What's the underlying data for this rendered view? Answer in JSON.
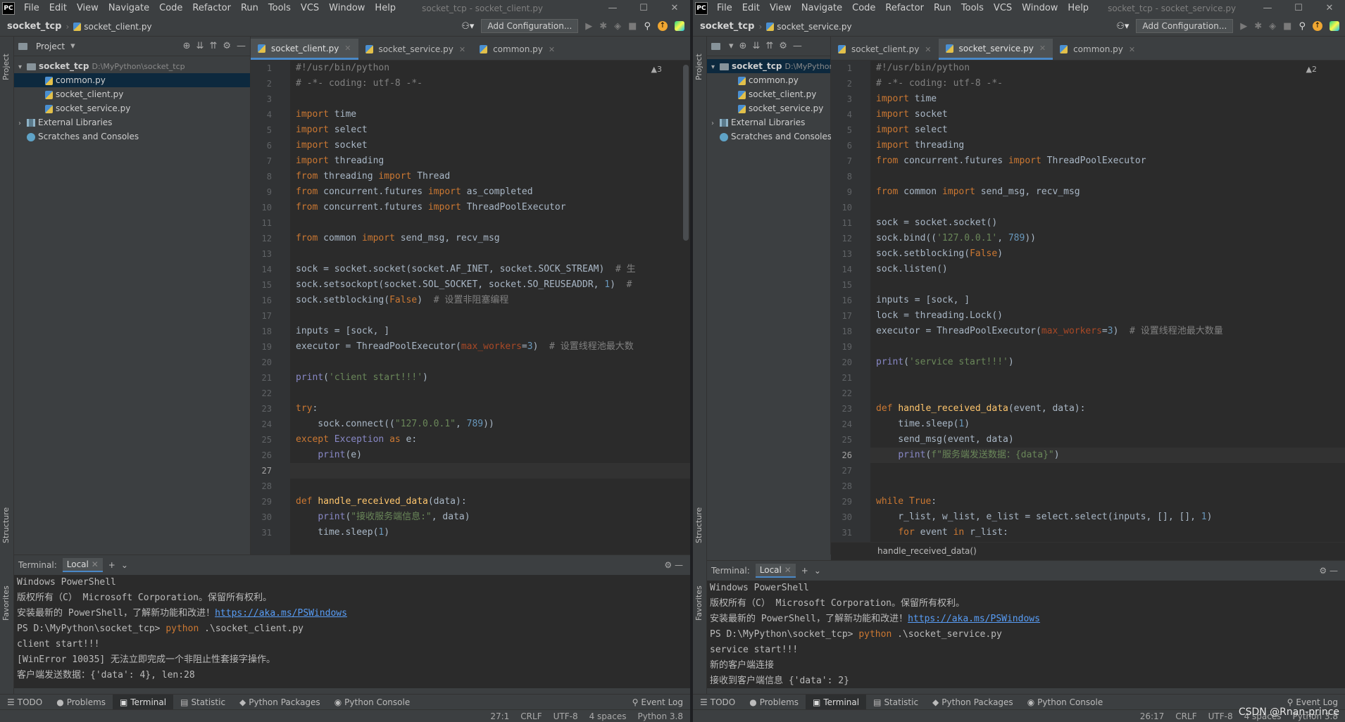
{
  "menu": [
    "File",
    "Edit",
    "View",
    "Navigate",
    "Code",
    "Refactor",
    "Run",
    "Tools",
    "VCS",
    "Window",
    "Help"
  ],
  "left": {
    "window_title": "socket_tcp - socket_client.py",
    "project_root": "socket_tcp",
    "current_file": "socket_client.py",
    "add_config": "Add Configuration...",
    "project_label": "Project",
    "tree": {
      "root": "socket_tcp",
      "root_path": "D:\\MyPython\\socket_tcp",
      "files": [
        "common.py",
        "socket_client.py",
        "socket_service.py"
      ],
      "ext_libs": "External Libraries",
      "scratches": "Scratches and Consoles"
    },
    "tabs": [
      "socket_client.py",
      "socket_service.py",
      "common.py"
    ],
    "warn": "▲3",
    "line_numbers": [
      "1",
      "2",
      "3",
      "4",
      "5",
      "6",
      "7",
      "8",
      "9",
      "10",
      "11",
      "12",
      "13",
      "14",
      "15",
      "16",
      "17",
      "18",
      "19",
      "20",
      "21",
      "22",
      "23",
      "24",
      "25",
      "26",
      "27",
      "28",
      "29",
      "30",
      "31"
    ],
    "terminal": {
      "label": "Terminal:",
      "tab": "Local",
      "lines": [
        "Windows PowerShell",
        "版权所有（C） Microsoft Corporation。保留所有权利。",
        "安装最新的 PowerShell，了解新功能和改进！",
        "PS D:\\MyPython\\socket_tcp> ",
        "client start!!!",
        "[WinError 10035] 无法立即完成一个非阻止性套接字操作。",
        "客户端发送数据：{'data': 4}, len:28"
      ],
      "link": "https://aka.ms/PSWindows",
      "cmd_kw": "python",
      "cmd_arg": " .\\socket_client.py"
    },
    "status": [
      "27:1",
      "CRLF",
      "UTF-8",
      "4 spaces",
      "Python 3.8"
    ]
  },
  "right": {
    "window_title": "socket_tcp - socket_service.py",
    "project_root": "socket_tcp",
    "current_file": "socket_service.py",
    "add_config": "Add Configuration...",
    "tree": {
      "root": "socket_tcp",
      "root_path": "D:\\MyPython",
      "files": [
        "common.py",
        "socket_client.py",
        "socket_service.py"
      ],
      "ext_libs": "External Libraries",
      "scratches": "Scratches and Consoles"
    },
    "tabs": [
      "socket_client.py",
      "socket_service.py",
      "common.py"
    ],
    "warn": "▲2",
    "line_numbers": [
      "1",
      "2",
      "3",
      "4",
      "5",
      "6",
      "7",
      "8",
      "9",
      "10",
      "11",
      "12",
      "13",
      "14",
      "15",
      "16",
      "17",
      "18",
      "19",
      "20",
      "21",
      "22",
      "23",
      "24",
      "25",
      "26",
      "27",
      "28",
      "29",
      "30",
      "31"
    ],
    "breadcrumb_fn": "handle_received_data()",
    "terminal": {
      "label": "Terminal:",
      "tab": "Local",
      "lines": [
        "Windows PowerShell",
        "版权所有（C） Microsoft Corporation。保留所有权利。",
        "安装最新的 PowerShell，了解新功能和改进！",
        "PS D:\\MyPython\\socket_tcp> ",
        "service start!!!",
        "新的客户端连接",
        "接收到客户端信息 {'data': 2}"
      ],
      "link": "https://aka.ms/PSWindows",
      "cmd_kw": "python",
      "cmd_arg": " .\\socket_service.py"
    },
    "status": [
      "26:17",
      "CRLF",
      "UTF-8",
      "4 spaces",
      "Python 3.8"
    ]
  },
  "bottom_tools": [
    "TODO",
    "Problems",
    "Terminal",
    "Statistic",
    "Python Packages",
    "Python Console"
  ],
  "event_log": "Event Log",
  "side_labels": {
    "project": "Project",
    "structure": "Structure",
    "favorites": "Favorites"
  },
  "watermark": "CSDN @Rnan-prince"
}
